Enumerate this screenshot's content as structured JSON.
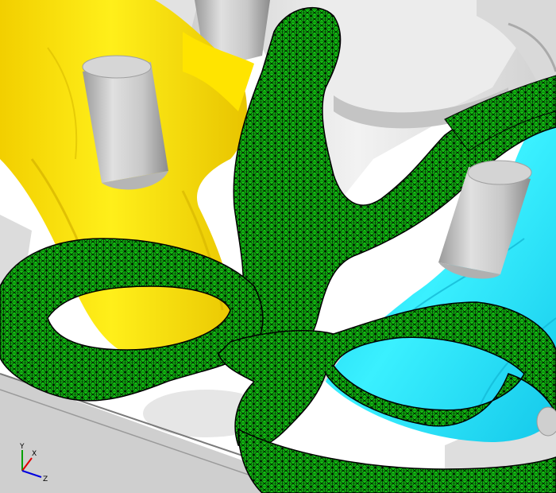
{
  "viewport": {
    "description_colors": {
      "background": "#ffffff",
      "housing": "#e6e6e6",
      "housing_shadow": "#bdbdbd",
      "intake_port": "#ffee00",
      "intake_port_shade": "#e0c800",
      "exhaust_port": "#22e6ff",
      "exhaust_port_shade": "#10b8d8",
      "water_jacket_mesh": "#11c011",
      "mesh_lines": "#000000",
      "valve_guide": "#bfbfbf"
    }
  },
  "triad": {
    "x_label": "X",
    "y_label": "Y",
    "z_label": "Z",
    "x_color": "#e00000",
    "y_color": "#00a000",
    "z_color": "#0000e0"
  }
}
